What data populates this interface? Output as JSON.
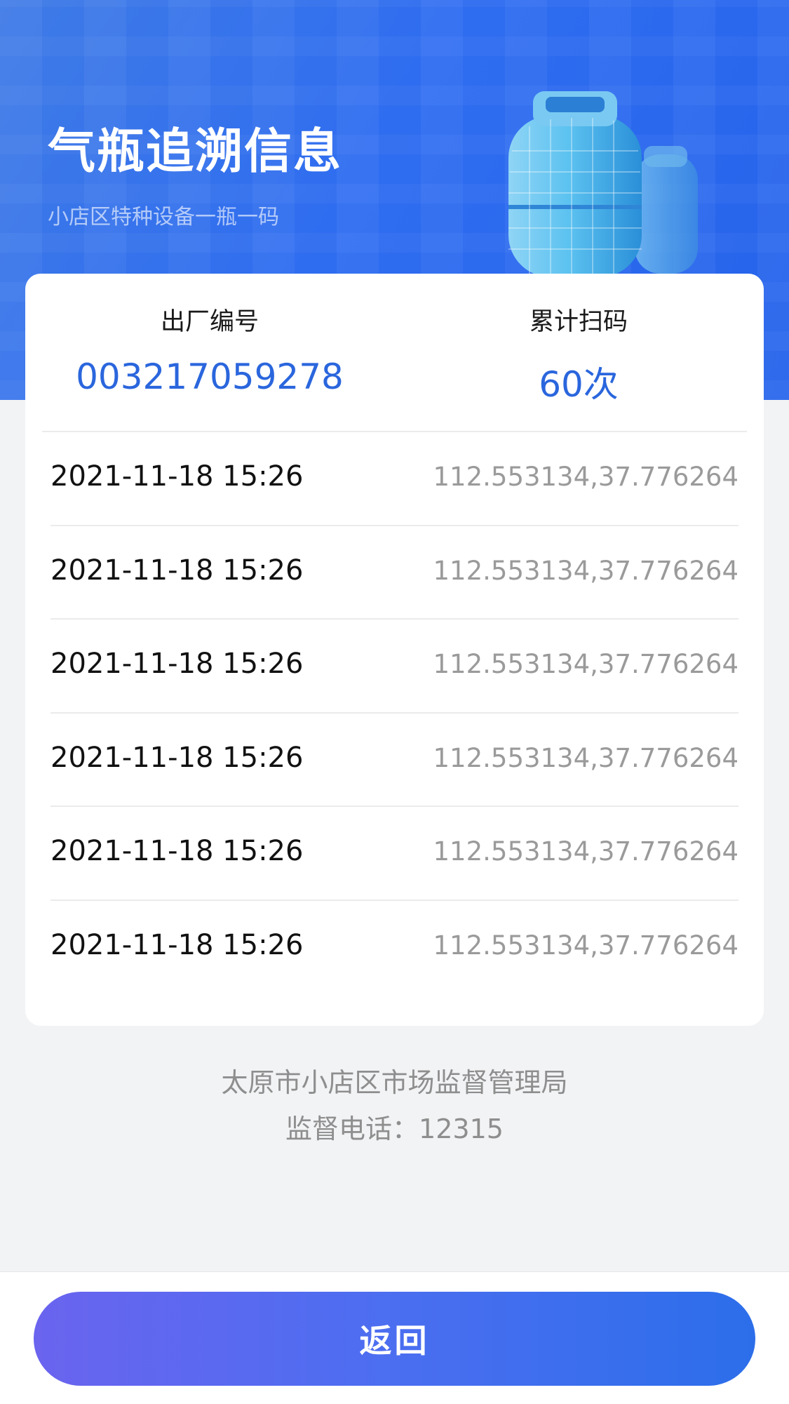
{
  "header": {
    "title": "气瓶追溯信息",
    "subtitle": "小店区特种设备一瓶一码"
  },
  "summary": {
    "serial_label": "出厂编号",
    "serial_value": "003217059278",
    "scan_label": "累计扫码",
    "scan_value": "60次"
  },
  "records": [
    {
      "time": "2021-11-18 15:26",
      "location": "112.553134,37.776264"
    },
    {
      "time": "2021-11-18 15:26",
      "location": "112.553134,37.776264"
    },
    {
      "time": "2021-11-18 15:26",
      "location": "112.553134,37.776264"
    },
    {
      "time": "2021-11-18 15:26",
      "location": "112.553134,37.776264"
    },
    {
      "time": "2021-11-18 15:26",
      "location": "112.553134,37.776264"
    },
    {
      "time": "2021-11-18 15:26",
      "location": "112.553134,37.776264"
    }
  ],
  "footer": {
    "org": "太原市小店区市场监督管理局",
    "phone": "监督电话：12315"
  },
  "actions": {
    "back_label": "返回"
  },
  "colors": {
    "header_blue": "#2f6df0",
    "value_blue": "#2a66dd",
    "button_gradient_start": "#6a64ef",
    "button_gradient_end": "#2c6eea"
  },
  "icons": {
    "hero_image": "gas-cylinder-illustration"
  }
}
